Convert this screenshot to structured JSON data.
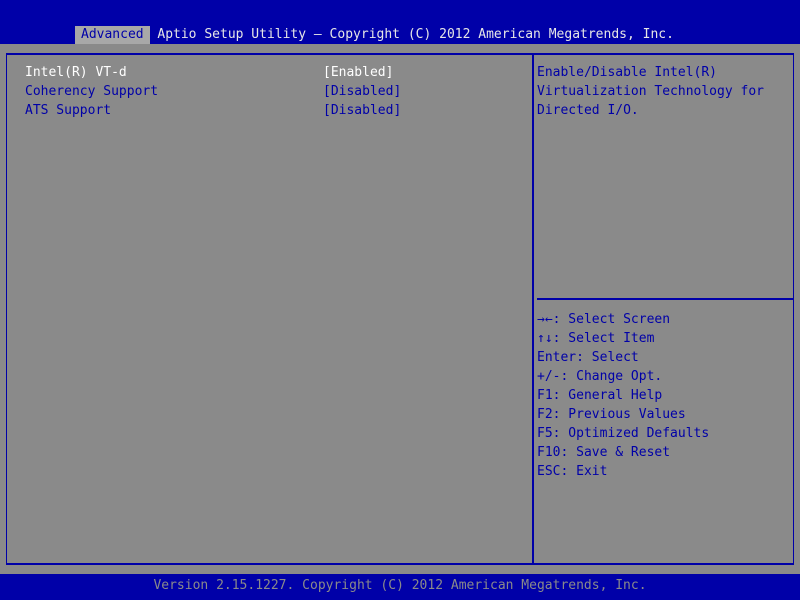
{
  "window": {
    "title": "Aptio Setup Utility – Copyright (C) 2012 American Megatrends, Inc."
  },
  "tabs": [
    {
      "label": "Advanced",
      "active": true
    }
  ],
  "settings": [
    {
      "label": "Intel(R) VT-d",
      "value": "[Enabled]",
      "selected": true
    },
    {
      "label": "Coherency Support",
      "value": "[Disabled]",
      "selected": false
    },
    {
      "label": "ATS Support",
      "value": "[Disabled]",
      "selected": false
    }
  ],
  "help": {
    "lines": [
      "Enable/Disable Intel(R)",
      "Virtualization Technology for",
      "Directed I/O."
    ]
  },
  "keys": [
    "→←: Select Screen",
    "↑↓: Select Item",
    "Enter: Select",
    "+/-: Change Opt.",
    "F1: General Help",
    "F2: Previous Values",
    "F5: Optimized Defaults",
    "F10: Save & Reset",
    "ESC: Exit"
  ],
  "footer": {
    "text": "Version 2.15.1227. Copyright (C) 2012 American Megatrends, Inc."
  },
  "colors": {
    "background": "#0000A8",
    "panel": "#8A8A8A",
    "tab": "#A8A8A8",
    "selected_text": "#FFFFFF",
    "text": "#0000A8"
  }
}
